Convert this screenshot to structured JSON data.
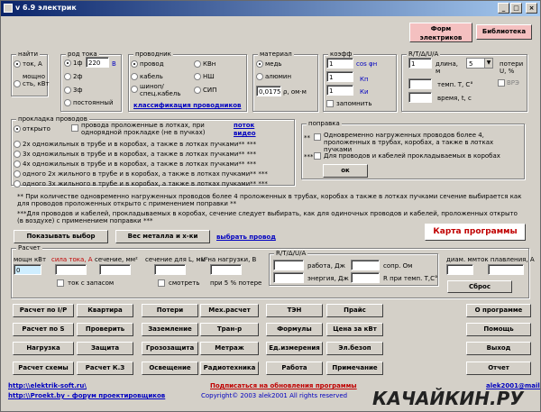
{
  "titlebar": {
    "title": "v 6.9 электрик",
    "btn_min": "_",
    "btn_max": "□",
    "btn_close": "×"
  },
  "topbar": {
    "forms_button": "Форм электриков",
    "library_button": "Библиотека"
  },
  "params": {
    "find_legend": "найти",
    "find_current": "ток, А",
    "find_power_a": "мощно",
    "find_power_b": "сть, кВт",
    "current_legend": "род тока",
    "current_1f": "1ф",
    "voltage_value": "220",
    "voltage_unit": "В",
    "current_2f": "2ф",
    "current_3f": "3ф",
    "current_dc": "постоянный",
    "conductor_legend": "проводник",
    "cond_wire": "провод",
    "cond_cable": "кабель",
    "cond_busbar_a": "шиноп/",
    "cond_busbar_b": "спец.кабель",
    "cond_kvn": "КВн",
    "cond_nsh": "НШ",
    "cond_sip": "СИП",
    "conductor_class_link": "классификация проводников",
    "material_legend": "материал",
    "mat_copper": "медь",
    "mat_aluminum": "алюмин",
    "resistivity_value": "0,0175",
    "resistivity_unit": "ρ, ом·м",
    "coef_legend": "коэфф",
    "coef_k1": "1",
    "coef_k1_label": "cos φн",
    "coef_k2": "1",
    "coef_k2_label": "Кп",
    "coef_k3": "1",
    "coef_k3_label": "Ки",
    "remember_label": "запомнить",
    "rtlua_legend": "R/T/Δ/U/A",
    "length_value": "1",
    "length_label": "длина, м",
    "losses_select": "5",
    "losses_label": "потери U, %",
    "temp_label": "темп. T, C°",
    "time_label": "время, t, c",
    "pt_label": "ВРЭ",
    "losses_chk_label": "АРЦ"
  },
  "laying": {
    "legend": "прокладка проводов",
    "open_label": "открыто",
    "open_option_text": "провода проложенные в лотках, при однорядной прокладке (не в пучках)",
    "flow_link": "поток",
    "flow_link2": "видео",
    "opt_2": "2х одножильных в трубе и в коробах, а также в лотках пучками** ***",
    "opt_3": "3х одножильных в трубе и в коробах, а также в лотках пучками** ***",
    "opt_4": "4х одножильных в трубе и в коробах, а также в лотках пучками** ***",
    "opt_5": "одного 2х жильного в трубе и в коробах, а также в лотках пучками** ***",
    "opt_6": "одного 3х жильного в трубе и в коробах, а также в лотках пучками** ***",
    "laying2_legend": "поправка",
    "laying2_note1": "Одновременно нагруженных проводов более 4, проложенных в трубах, коробах, а также в лотках пучками",
    "laying2_note2": "Для проводов и кабелей прокладываемых в коробах",
    "ok_button": "ок",
    "footnote1": "** При количестве одновременно нагруженных проводов более 4 проложенных в трубах, коробах а также в лотках пучками сечение выбирается как для проводов проложенных открыто с применением поправки **",
    "footnote2": "***Для проводов и кабелей, прокладываемых в коробах, сечение следует выбирать, как для одиночных проводов и кабелей, проложенных открыто (в воздухе) с применением поправки ***",
    "show_selection_button": "Показывать выбор",
    "metal_weight_button": "Вес металла и х-ки",
    "select_wire_link": "выбрать провод",
    "program_map_button": "Карта программы"
  },
  "calc": {
    "legend": "Расчет",
    "power_label": "мощн кВт",
    "power_value": "0",
    "current_label": "сила тока, А",
    "section_label": "сечение, мм²",
    "with_reserve_label": "ток с запасом",
    "section_l_label": "сечение для L, мм²",
    "load_u_label": "U на нагрузки, В",
    "view_label": "смотреть",
    "at5_label": "при 5 % потере",
    "rtlua_legend": "R/T/Δ/U/A",
    "work_label": "работа, Дж",
    "energy_label": "энергия, Дж",
    "resist_label": "сопр. Ом",
    "r_at_temp_label": "R при темп. T,C°",
    "diam_label": "диам. мм",
    "melt_current_label": "ток плавления, А",
    "reset_button": "Сброс"
  },
  "buttons": [
    [
      "Расчет по I/P",
      "Квартира",
      "Потери",
      "Мех.расчет",
      "ТЭН",
      "Прайс",
      "О программе"
    ],
    [
      "Расчет по S",
      "Проверить",
      "Заземление",
      "Тран-р",
      "Формулы",
      "Цена за кВт",
      "Помощь"
    ],
    [
      "Нагрузка",
      "Защита",
      "Грозозащита",
      "Метраж",
      "Ед.измерения",
      "Эл.безоп",
      "Выход"
    ],
    [
      "Расчет схемы",
      "Расчет К.З",
      "Освещение",
      "Радиотехника",
      "Работа",
      "Примечание",
      "Отчет"
    ]
  ],
  "footer": {
    "site_link": "http:\\\\elektrik-soft.ru\\",
    "forum_link": "http:\\\\Proekt.by - форум проектировщиков",
    "subscribe": "Подписаться на обновления программы",
    "copyright": "Copyright© 2003 alek2001 All rights reserved",
    "email": "alek2001@mail.ru",
    "watermark": "КАЧАЙКИН.РУ"
  }
}
